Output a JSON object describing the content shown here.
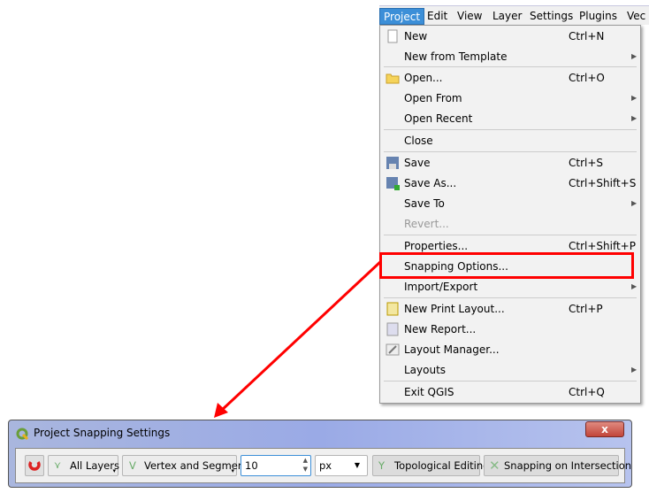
{
  "menubar": {
    "items": [
      "Project",
      "Edit",
      "View",
      "Layer",
      "Settings",
      "Plugins",
      "Vec"
    ]
  },
  "menu": {
    "items": [
      {
        "label": "New",
        "shortcut": "Ctrl+N",
        "icon": "new-file-icon"
      },
      {
        "label": "New from Template",
        "submenu": true
      },
      {
        "label": "Open...",
        "shortcut": "Ctrl+O",
        "icon": "folder-icon"
      },
      {
        "label": "Open From",
        "submenu": true
      },
      {
        "label": "Open Recent",
        "submenu": true
      },
      {
        "label": "Close"
      },
      {
        "label": "Save",
        "shortcut": "Ctrl+S",
        "icon": "save-icon"
      },
      {
        "label": "Save As...",
        "shortcut": "Ctrl+Shift+S",
        "icon": "save-as-icon"
      },
      {
        "label": "Save To",
        "submenu": true
      },
      {
        "label": "Revert...",
        "disabled": true
      },
      {
        "label": "Properties...",
        "shortcut": "Ctrl+Shift+P"
      },
      {
        "label": "Snapping Options...",
        "highlighted": true
      },
      {
        "label": "Import/Export",
        "submenu": true
      },
      {
        "label": "New Print Layout...",
        "shortcut": "Ctrl+P",
        "icon": "print-layout-icon"
      },
      {
        "label": "New Report...",
        "icon": "report-icon"
      },
      {
        "label": "Layout Manager...",
        "icon": "layout-manager-icon"
      },
      {
        "label": "Layouts",
        "submenu": true
      },
      {
        "label": "Exit QGIS",
        "shortcut": "Ctrl+Q"
      }
    ]
  },
  "dialog": {
    "title": "Project Snapping Settings",
    "close": "x",
    "layers": "All Layers",
    "mode": "Vertex and Segment",
    "tolerance": "10",
    "units": "px",
    "topological": "Topological Editing",
    "intersection": "Snapping on Intersection"
  },
  "colors": {
    "highlight": "#ff0000",
    "menu_active": "#3c8fd8"
  }
}
